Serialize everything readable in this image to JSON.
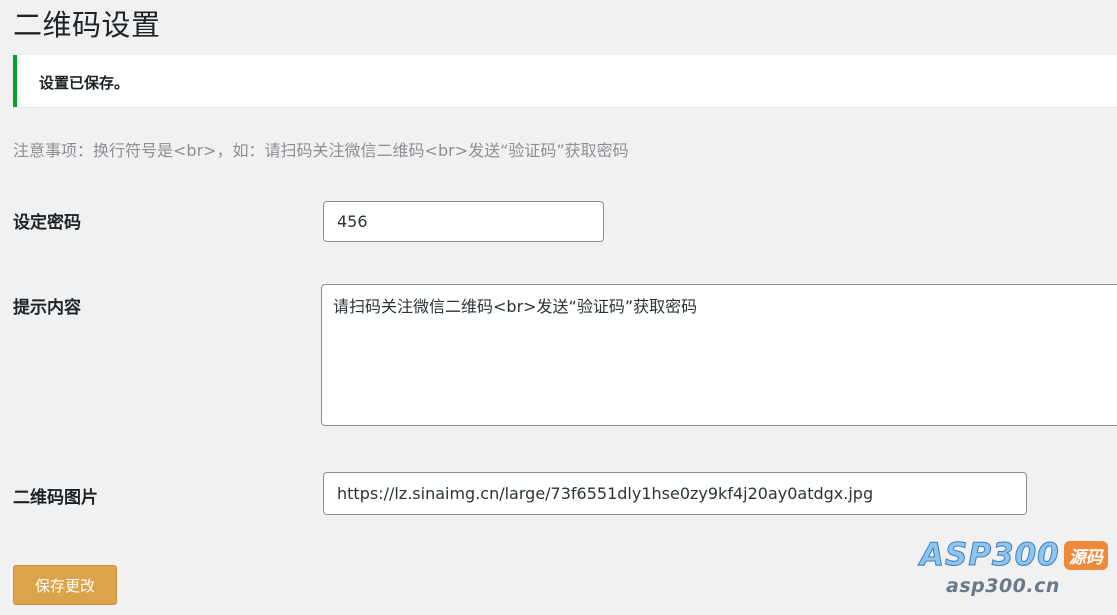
{
  "page_title": "二维码设置",
  "notice": {
    "text": "设置已保存。",
    "color": "#00a32a"
  },
  "note": "注意事项：换行符号是<br>，如：请扫码关注微信二维码<br>发送“验证码”获取密码",
  "fields": {
    "password": {
      "label": "设定密码",
      "value": "456"
    },
    "tip": {
      "label": "提示内容",
      "value": "请扫码关注微信二维码<br>发送“验证码”获取密码"
    },
    "qrcode": {
      "label": "二维码图片",
      "value": "https://lz.sinaimg.cn/large/73f6551dly1hse0zy9kf4j20ay0atdgx.jpg"
    }
  },
  "save_button": {
    "label": "保存更改",
    "color": "#dba44b"
  },
  "watermark": {
    "brand": "ASP300",
    "badge": "源码",
    "url": "asp300.cn"
  }
}
